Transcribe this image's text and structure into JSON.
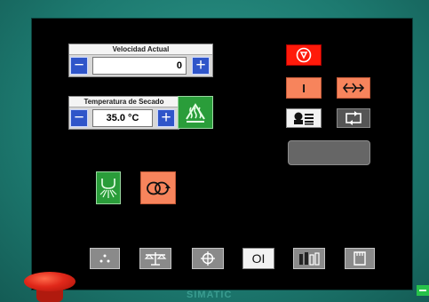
{
  "speed_panel": {
    "title": "Velocidad Actual",
    "value": "0",
    "minus": "−",
    "plus": "+"
  },
  "temp_panel": {
    "title": "Temperatura de Secado",
    "value": "35.0 °C",
    "minus": "−",
    "plus": "+"
  },
  "controls": {
    "on_label": "I",
    "mode_label": "OI"
  },
  "brand": "SIMATIC",
  "colors": {
    "accent_salmon": "#f7845c",
    "green": "#2a9d3a",
    "blue": "#2f55c9",
    "stop_red": "#ff1a0a",
    "bezel_teal": "#1d7a70"
  },
  "icons": {
    "heat": "heater-icon",
    "stop": "stop-icon",
    "direction": "direction-arrows-icon",
    "manual": "manual-list-icon",
    "cycle": "cycle-icon",
    "spray": "spray-nozzle-icon",
    "loop": "loop-icon",
    "nav": [
      "dots-icon",
      "scale-icon",
      "crosshair-icon",
      "on-off-icon",
      "gauges-icon",
      "memory-icon"
    ]
  }
}
